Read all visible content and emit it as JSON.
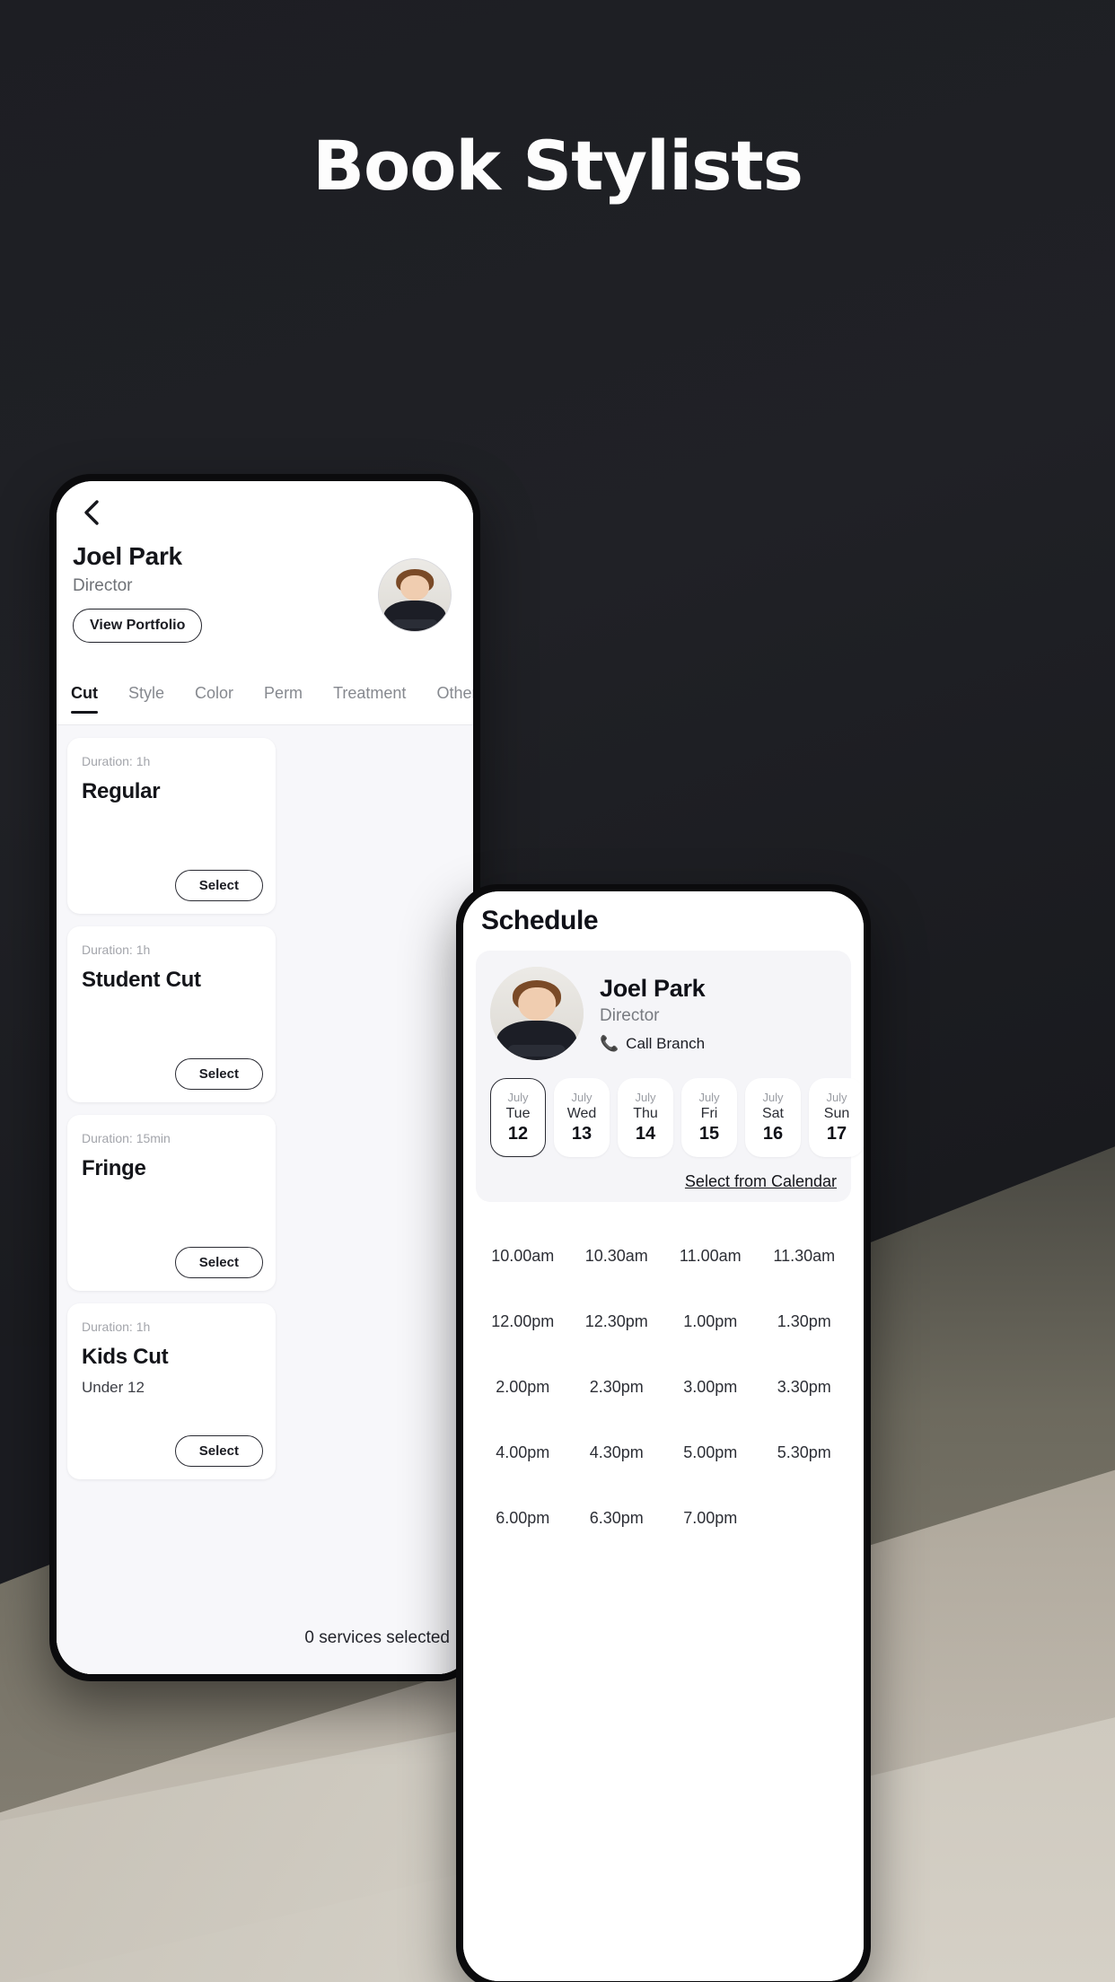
{
  "hero": {
    "title": "Book Stylists"
  },
  "colors": {
    "background_dark": "#1b1c21",
    "accent_dark": "#15161b",
    "card_bg": "#ffffff",
    "screen_bg": "#f7f7fa",
    "muted_text": "#86898f"
  },
  "phone_one": {
    "back_icon": "chevron-left-icon",
    "stylist": {
      "name": "Joel Park",
      "role": "Director",
      "portfolio_button": "View Portfolio",
      "avatar_icon": "avatar-photo"
    },
    "tabs": [
      {
        "label": "Cut",
        "active": true
      },
      {
        "label": "Style",
        "active": false
      },
      {
        "label": "Color",
        "active": false
      },
      {
        "label": "Perm",
        "active": false
      },
      {
        "label": "Treatment",
        "active": false
      },
      {
        "label": "Others",
        "active": false
      }
    ],
    "services": [
      {
        "duration": "Duration: 1h",
        "title": "Regular",
        "subtitle": "",
        "action": "Select"
      },
      {
        "duration": "Duration: 1h",
        "title": "Student Cut",
        "subtitle": "",
        "action": "Select"
      },
      {
        "duration": "Duration: 15min",
        "title": "Fringe",
        "subtitle": "",
        "action": "Select"
      },
      {
        "duration": "Duration: 1h",
        "title": "Kids Cut",
        "subtitle": "Under 12",
        "action": "Select"
      }
    ],
    "footer": {
      "status": "0 services selected"
    }
  },
  "phone_two": {
    "title": "Schedule",
    "stylist": {
      "name": "Joel Park",
      "role": "Director",
      "call_label": "Call Branch",
      "call_icon": "phone-icon",
      "avatar_icon": "avatar-photo"
    },
    "dates": [
      {
        "month": "July",
        "day": "Tue",
        "num": "12",
        "selected": true
      },
      {
        "month": "July",
        "day": "Wed",
        "num": "13",
        "selected": false
      },
      {
        "month": "July",
        "day": "Thu",
        "num": "14",
        "selected": false
      },
      {
        "month": "July",
        "day": "Fri",
        "num": "15",
        "selected": false
      },
      {
        "month": "July",
        "day": "Sat",
        "num": "16",
        "selected": false
      },
      {
        "month": "July",
        "day": "Sun",
        "num": "17",
        "selected": false
      }
    ],
    "calendar_link": "Select from Calendar",
    "time_slots": [
      "10.00am",
      "10.30am",
      "11.00am",
      "11.30am",
      "12.00pm",
      "12.30pm",
      "1.00pm",
      "1.30pm",
      "2.00pm",
      "2.30pm",
      "3.00pm",
      "3.30pm",
      "4.00pm",
      "4.30pm",
      "5.00pm",
      "5.30pm",
      "6.00pm",
      "6.30pm",
      "7.00pm"
    ]
  }
}
